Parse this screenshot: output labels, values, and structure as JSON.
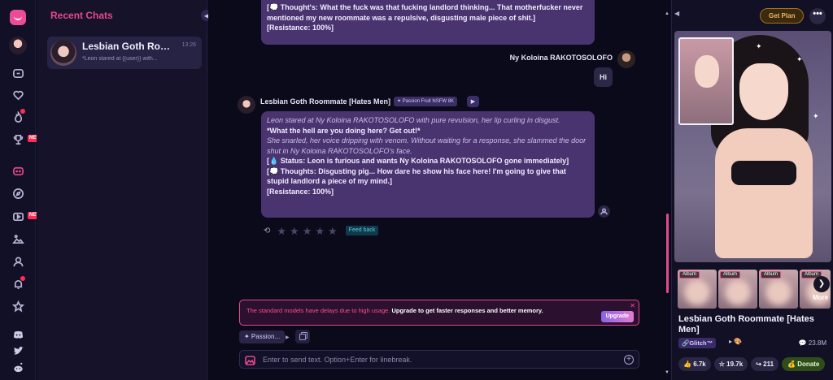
{
  "sidebar": {
    "recent_title": "Recent Chats",
    "new_badge": "NEW",
    "icons": [
      "logo-icon",
      "avatar",
      "chat-bubble-icon",
      "heart-icon",
      "fire-icon",
      "trophy-icon",
      "discord-chat-icon",
      "compass-icon",
      "video-icon",
      "image-icon",
      "user-icon",
      "bell-icon",
      "star-icon",
      "discord-icon",
      "twitter-icon",
      "reddit-icon"
    ]
  },
  "recent_chats": [
    {
      "name": "Lesbian Goth Roommate [Hates Men]",
      "time": "13:26",
      "preview": "*Leon stared at {{user}} with..."
    }
  ],
  "conversation": {
    "top_bubble": {
      "line1": "[💭 Thought's: What the fuck was that fucking landlord thinking... That motherfucker never mentioned my new roommate was a repulsive, disgusting male piece of shit.]",
      "line2": "[Resistance: 100%]"
    },
    "user": {
      "name": "Ny Koloina RAKOTOSOLOFO",
      "message": "Hi"
    },
    "bot": {
      "name": "Lesbian Goth Roommate [Hates Men]",
      "model_tag": "✦ Passion Fruit NSFW 8K",
      "lines": [
        {
          "style": "italic",
          "text": "Leon stared at Ny Koloina RAKOTOSOLOFO with pure revulsion, her lip curling in disgust."
        },
        {
          "style": "bold",
          "text": "*What the hell are you doing here? Get out!*"
        },
        {
          "style": "italic",
          "text": "She snarled, her voice dripping with venom. Without waiting for a response, she slammed the door shut in Ny Koloina RAKOTOSOLOFO's face."
        },
        {
          "style": "bold",
          "text": "[💧 Status: Leon is furious and wants Ny Koloina RAKOTOSOLOFO gone immediately]"
        },
        {
          "style": "bold",
          "text": "[💭 Thoughts: Disgusting pig... How dare he show his face here! I'm going to give that stupid landlord a piece of my mind.]"
        },
        {
          "style": "bold",
          "text": "[Resistance: 100%]"
        }
      ],
      "rating": 0,
      "rating_max": 5,
      "feedback_label": "Feed back"
    }
  },
  "banner": {
    "text": "The standard models have delays due to high usage. ",
    "text_strong": "Upgrade to get faster responses and better memory.",
    "upgrade_label": "Upgrade",
    "close": "✕"
  },
  "composer": {
    "model_label": "✦ Passion...",
    "placeholder": "Enter to send text. Option+Enter for linebreak."
  },
  "character": {
    "get_plan": "Get Plan",
    "more": "•••",
    "album_label": "Album",
    "more_label": "More",
    "name": "Lesbian Goth Roommate [Hates Men]",
    "creator": "🔗Glitch™",
    "tokens": "23.8M",
    "likes": "6.7k",
    "stars": "19.7k",
    "shares": "211",
    "donate": "Donate"
  },
  "colors": {
    "accent": "#e5498a",
    "bubble": "#4a3470",
    "background": "#0b0a1b"
  }
}
